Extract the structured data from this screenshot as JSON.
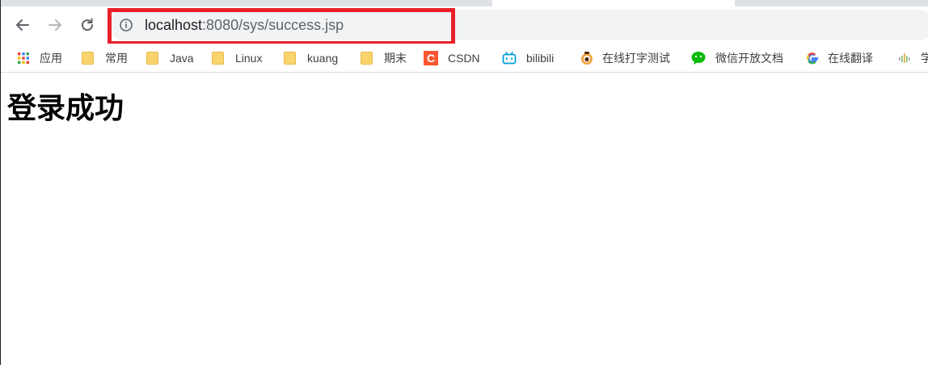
{
  "address_bar": {
    "host": "localhost",
    "path": ":8080/sys/success.jsp"
  },
  "bookmarks": [
    {
      "label": "应用",
      "icon": "apps-grid-icon"
    },
    {
      "label": "常用",
      "icon": "folder-icon"
    },
    {
      "label": "Java",
      "icon": "folder-icon"
    },
    {
      "label": "Linux",
      "icon": "folder-icon"
    },
    {
      "label": "kuang",
      "icon": "folder-icon"
    },
    {
      "label": "期末",
      "icon": "folder-icon"
    },
    {
      "label": "CSDN",
      "icon": "csdn-icon"
    },
    {
      "label": "bilibili",
      "icon": "bilibili-icon"
    },
    {
      "label": "在线打字测试",
      "icon": "typing-test-icon"
    },
    {
      "label": "微信开放文档",
      "icon": "wechat-icon"
    },
    {
      "label": "在线翻译",
      "icon": "google-icon"
    },
    {
      "label": "学",
      "icon": "audio-wave-icon"
    }
  ],
  "page": {
    "heading": "登录成功"
  },
  "colors": {
    "highlight": "#e8202a",
    "folder": "#f9d46d",
    "csdn": "#fc5531",
    "bilibili": "#00a1d6",
    "wechat": "#09bb07"
  },
  "icons": {
    "csdn_letter": "C"
  }
}
